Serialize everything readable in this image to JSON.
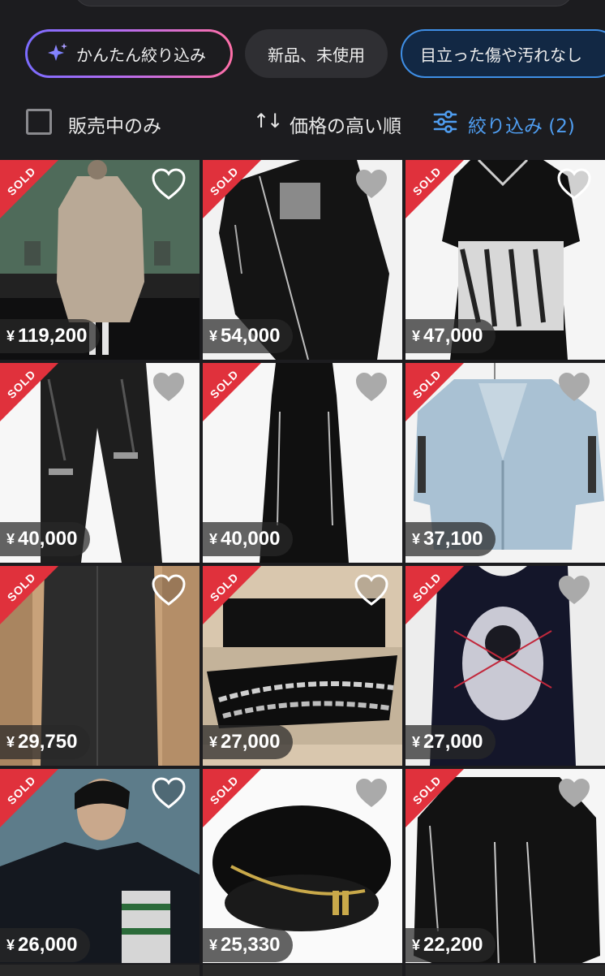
{
  "chips": {
    "ai_filter": "かんたん絞り込み",
    "new_unused": "新品、未使用",
    "no_damage": "目立った傷や汚れなし"
  },
  "filter_bar": {
    "on_sale_only": "販売中のみ",
    "sort_label": "価格の高い順",
    "filter_label": "絞り込み (2)"
  },
  "sold_badge": "SOLD",
  "colors": {
    "accent_blue": "#4f9df0",
    "sold_red": "#e0313c",
    "background": "#1c1c1f"
  },
  "items": [
    {
      "yen": "¥",
      "price": "119,200",
      "sold": true,
      "photo": "runway-beige-dress"
    },
    {
      "yen": "¥",
      "price": "54,000",
      "sold": true,
      "photo": "black-long-coat"
    },
    {
      "yen": "¥",
      "price": "47,000",
      "sold": true,
      "photo": "black-dress-print"
    },
    {
      "yen": "¥",
      "price": "40,000",
      "sold": true,
      "photo": "leather-pants"
    },
    {
      "yen": "¥",
      "price": "40,000",
      "sold": true,
      "photo": "black-overall"
    },
    {
      "yen": "¥",
      "price": "37,100",
      "sold": true,
      "photo": "denim-jacket"
    },
    {
      "yen": "¥",
      "price": "29,750",
      "sold": true,
      "photo": "grey-long-coat"
    },
    {
      "yen": "¥",
      "price": "27,000",
      "sold": true,
      "photo": "chain-necklace"
    },
    {
      "yen": "¥",
      "price": "27,000",
      "sold": true,
      "photo": "graphic-tank"
    },
    {
      "yen": "¥",
      "price": "26,000",
      "sold": true,
      "photo": "model-jacket"
    },
    {
      "yen": "¥",
      "price": "25,330",
      "sold": true,
      "photo": "black-beret"
    },
    {
      "yen": "¥",
      "price": "22,200",
      "sold": true,
      "photo": "black-coat-zip"
    }
  ]
}
